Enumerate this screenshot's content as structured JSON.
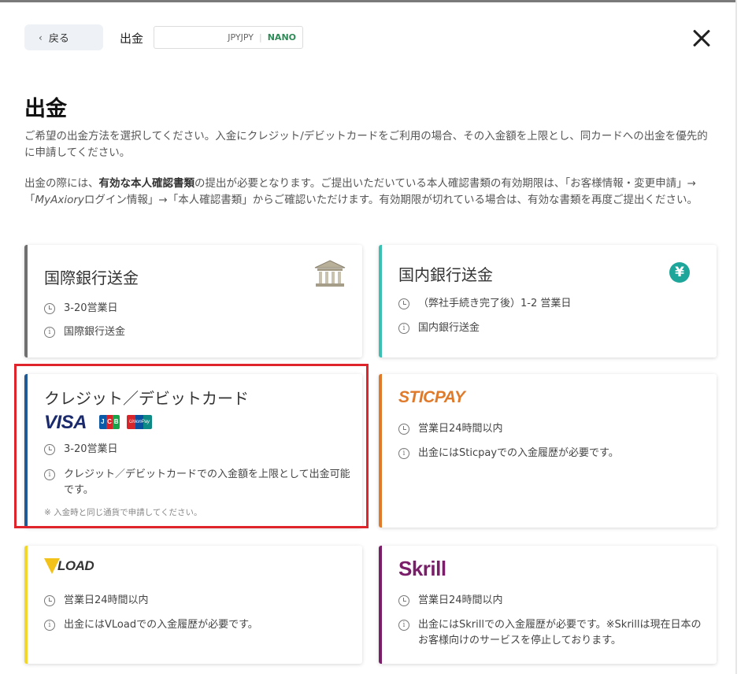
{
  "header": {
    "back_label": "戻る",
    "title": "出金",
    "account": {
      "currency": "JPYJPY",
      "type": "NANO"
    }
  },
  "page": {
    "title": "出金",
    "desc1": "ご希望の出金方法を選択してください。入金にクレジット/デビットカードをご利用の場合、その入金額を上限とし、同カードへの出金を優先的に申請してください。",
    "desc2": {
      "p1": "出金の際には、",
      "bold": "有効な本人確認書類",
      "p2": "の提出が必要となります。ご提出いただいている本人確認書類の有効期限は、「お客様情報・変更申請」→「",
      "italic": "MyAxiory",
      "p3": "ログイン情報」→「本人確認書類」からご確認いただけます。有効期限が切れている場合は、有効な書類を再度ご提出ください。"
    }
  },
  "methods": {
    "intl": {
      "name": "国際銀行送金",
      "time": "3-20営業日",
      "info": "国際銀行送金",
      "icon": "bank-icon"
    },
    "domestic": {
      "name": "国内銀行送金",
      "time": "（弊社手続き完了後）1-2 営業日",
      "info": "国内銀行送金",
      "icon": "yen-icon",
      "icon_glyph": "¥"
    },
    "credit": {
      "name": "クレジット／デビットカード",
      "logos": {
        "visa": "VISA",
        "jcb_j": "J",
        "jcb_c": "C",
        "jcb_b": "B",
        "unionpay": "UnionPay"
      },
      "time": "3-20営業日",
      "info": "クレジット／デビットカードでの入金額を上限として出金可能です。",
      "note": "※ 入金時と同じ通貨で申請してください。"
    },
    "sticpay": {
      "logo": "STICPAY",
      "time": "営業日24時間以内",
      "info": "出金にはSticpayでの入金履歴が必要です。"
    },
    "vload": {
      "logo": "LOAD",
      "time": "営業日24時間以内",
      "info": "出金にはVLoadでの入金履歴が必要です。"
    },
    "skrill": {
      "logo": "Skrill",
      "time": "営業日24時間以内",
      "info": "出金にはSkrillでの入金履歴が必要です。※Skrillは現在日本のお客様向けのサービスを停止しております。"
    }
  },
  "colors": {
    "accent_highlight": "#e0242b",
    "nano": "#2e8b57",
    "intl_border": "#707070",
    "domestic_border": "#3bbfb2",
    "credit_border": "#1f5a96",
    "sticpay": "#e07a2b",
    "vload": "#f2d62b",
    "skrill": "#7a1e6a"
  }
}
